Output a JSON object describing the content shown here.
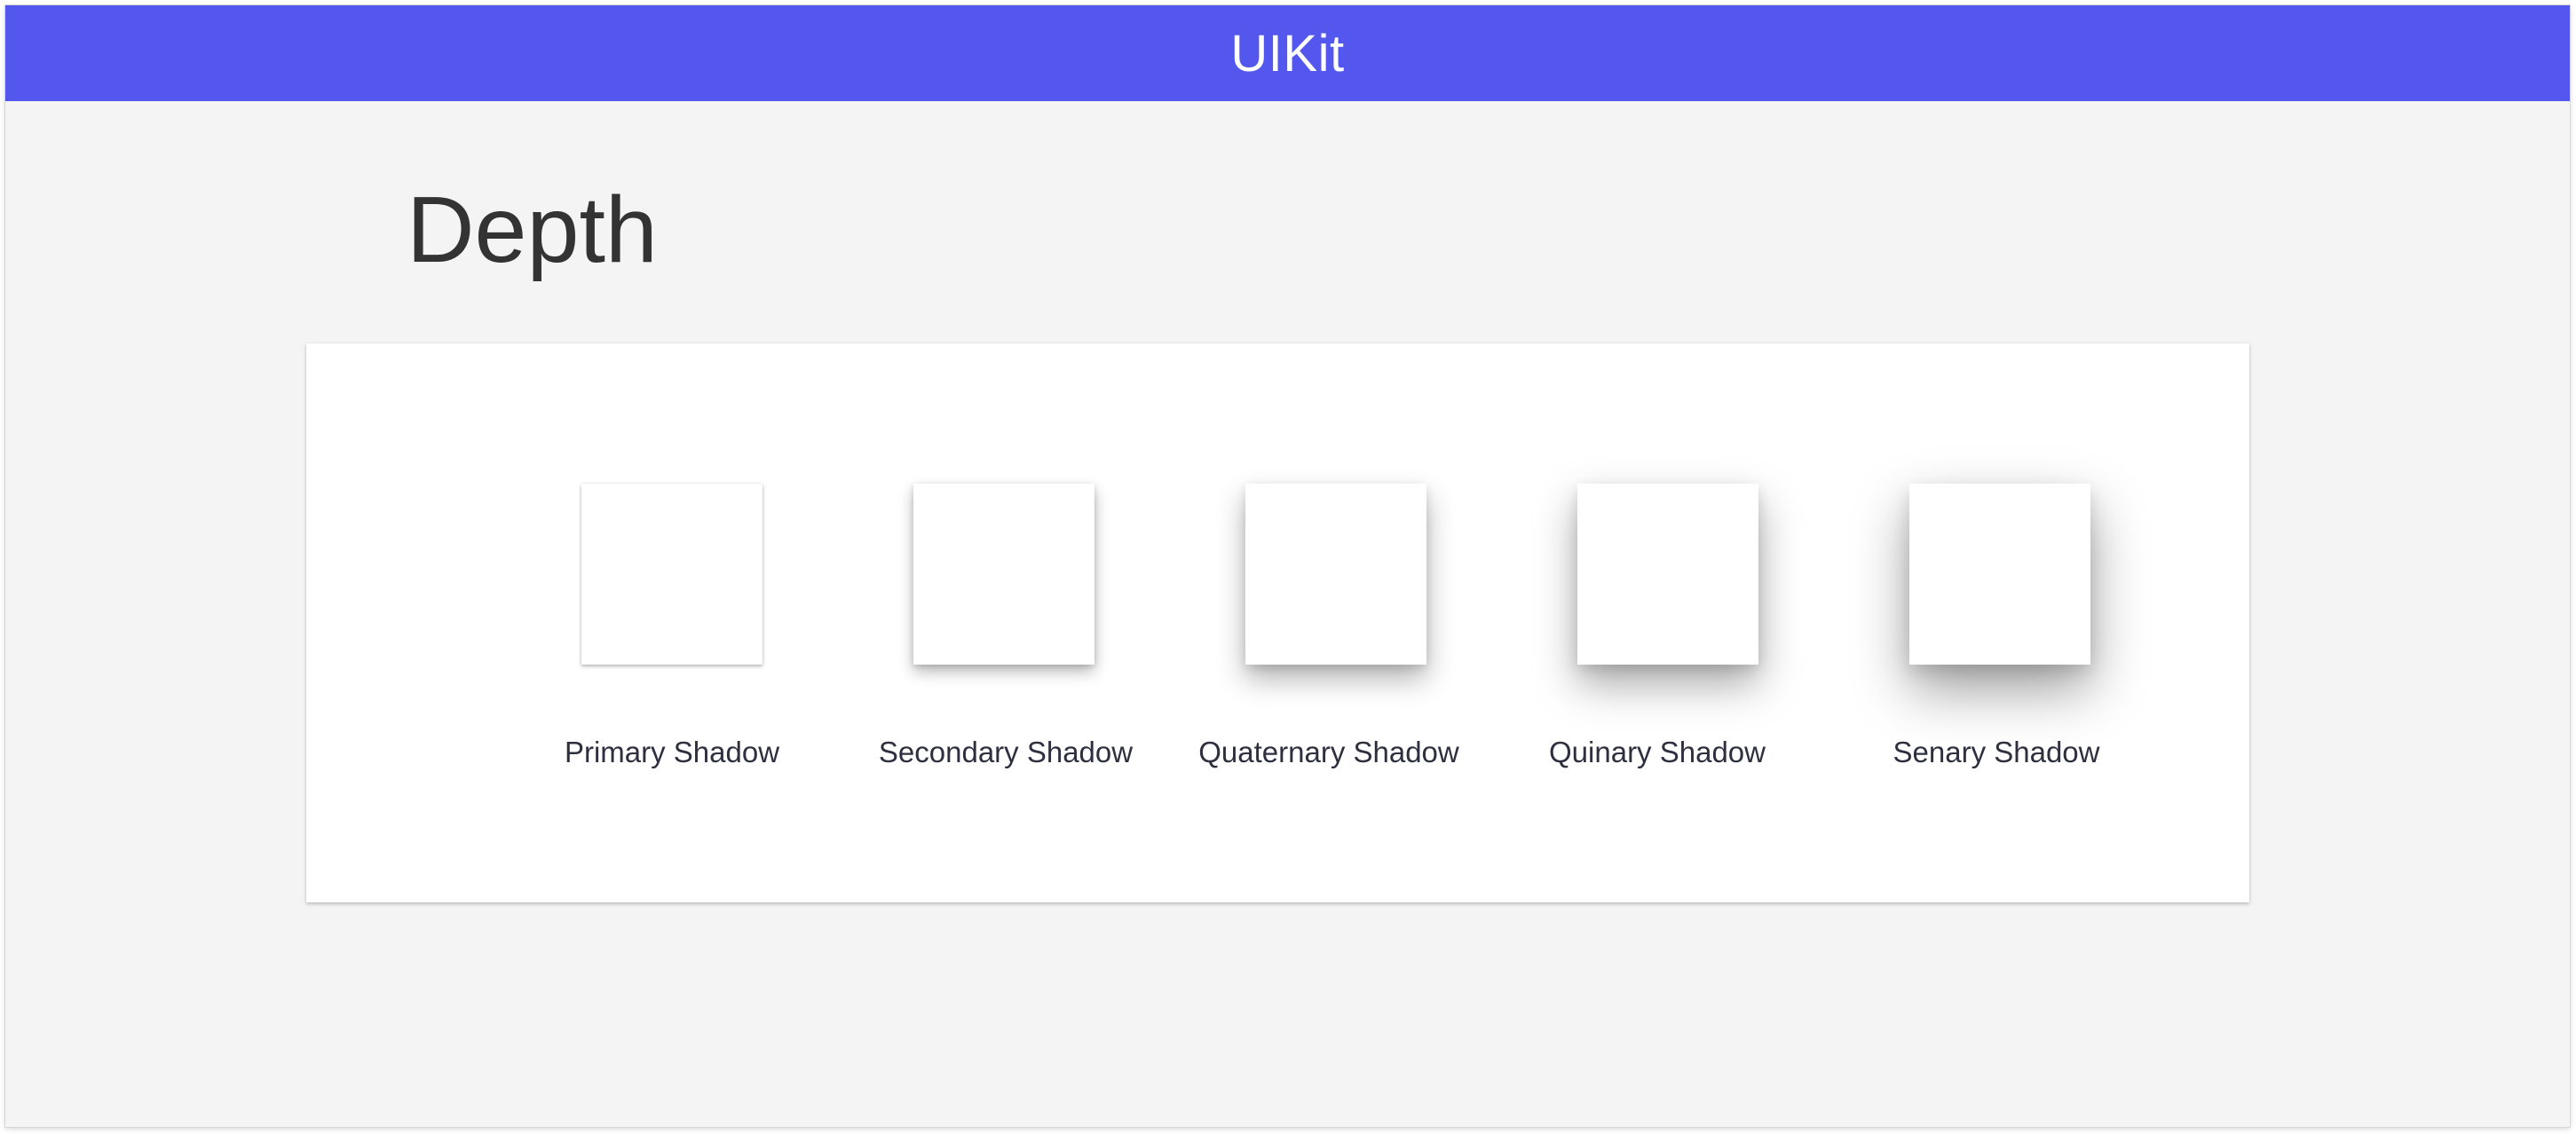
{
  "header": {
    "title": "UIKit",
    "background_color": "#5457ee"
  },
  "page": {
    "title": "Depth"
  },
  "depth_card": {
    "items": [
      {
        "label": "Primary Shadow"
      },
      {
        "label": "Secondary Shadow"
      },
      {
        "label": "Quaternary Shadow"
      },
      {
        "label": "Quinary Shadow"
      },
      {
        "label": "Senary Shadow"
      }
    ]
  }
}
